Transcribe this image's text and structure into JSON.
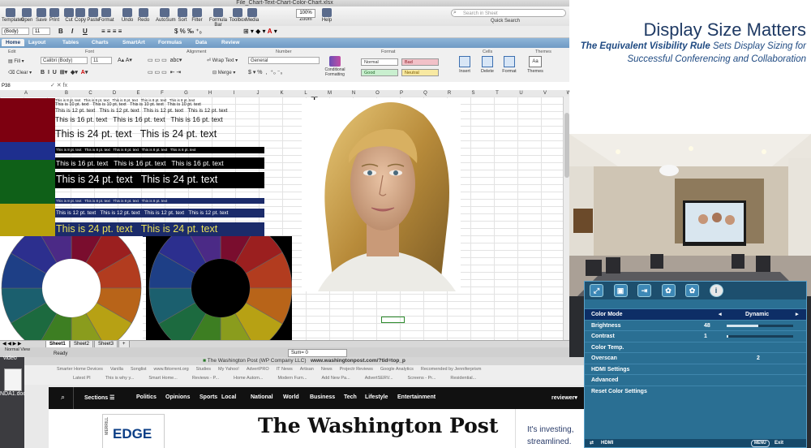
{
  "excel": {
    "window_title": "File_Chart-Text-Chart-Color-Chart.xlsx",
    "toolbar": [
      {
        "icon": "templates-icon",
        "label": "Templates"
      },
      {
        "icon": "open-icon",
        "label": "Open"
      },
      {
        "icon": "save-icon",
        "label": "Save"
      },
      {
        "icon": "print-icon",
        "label": "Print"
      },
      {
        "icon": "cut-icon",
        "label": "Cut"
      },
      {
        "icon": "copy-icon",
        "label": "Copy"
      },
      {
        "icon": "paste-icon",
        "label": "Paste"
      },
      {
        "icon": "format-icon",
        "label": "Format"
      },
      {
        "icon": "undo-icon",
        "label": "Undo"
      },
      {
        "icon": "redo-icon",
        "label": "Redo"
      },
      {
        "icon": "autosum-icon",
        "label": "AutoSum"
      },
      {
        "icon": "sort-icon",
        "label": "Sort"
      },
      {
        "icon": "filter-icon",
        "label": "Filter"
      },
      {
        "icon": "formula-bar-icon",
        "label": "Formula Bar"
      },
      {
        "icon": "toolbox-icon",
        "label": "Toolbox"
      },
      {
        "icon": "media-icon",
        "label": "Media"
      },
      {
        "icon": "zoom-icon",
        "label": "Zoom"
      },
      {
        "icon": "help-icon",
        "label": "Help"
      }
    ],
    "zoom_value": "100%",
    "search_placeholder": "Search in Sheet",
    "quick_search_label": "Quick Search",
    "format_bar": {
      "style": "(Body)",
      "size": "11",
      "bold": "B",
      "italic": "I",
      "underline": "U"
    },
    "ribbon_tabs": [
      "Home",
      "Layout",
      "Tables",
      "Charts",
      "SmartArt",
      "Formulas",
      "Data",
      "Review"
    ],
    "active_tab": "Home",
    "ribbon_groups": {
      "edit": "Edit",
      "font": "Font",
      "alignment": "Alignment",
      "number": "Number",
      "format": "Format",
      "cells": "Cells",
      "themes": "Themes"
    },
    "ribbon": {
      "fill_label": "Fill",
      "clear_label": "Clear",
      "font_name": "Calibri (Body)",
      "font_size": "11",
      "wrap_text": "Wrap Text",
      "merge": "Merge",
      "number_format": "General",
      "conditional_formatting": "Conditional Formatting",
      "styles": {
        "normal": "Normal",
        "bad": "Bad",
        "good": "Good",
        "neutral": "Neutral"
      },
      "insert": "Insert",
      "delete": "Delete",
      "format": "Format",
      "themes": "Themes"
    },
    "name_box": "P38",
    "columns": [
      "A",
      "B",
      "C",
      "D",
      "E",
      "F",
      "G",
      "H",
      "I",
      "J",
      "K",
      "L",
      "M",
      "N",
      "O",
      "P",
      "Q",
      "R",
      "S",
      "T",
      "U",
      "V",
      "W"
    ],
    "text_rows": {
      "t8": "This is 8 pt. text",
      "t10": "This is 10 pt. text",
      "t12": "This is 12 pt. text",
      "t16": "This is 16 pt. text",
      "t24": "This is 24 pt. text"
    },
    "sheet_tabs": [
      "Sheet1",
      "Sheet2",
      "Sheet3"
    ],
    "active_sheet": "Sheet1",
    "status": {
      "view": "Normal View",
      "ready": "Ready",
      "sum": "Sum= 0"
    }
  },
  "slide": {
    "title": "Display Size Matters",
    "subtitle_emphasis": "The Equivalent Visibility Rule",
    "subtitle_rest": " Sets Display Sizing for",
    "subtitle_line2": "Successful Conferencing and Collaboration"
  },
  "osd": {
    "rows": [
      {
        "label": "Color Mode",
        "value": "Dynamic",
        "selected": true
      },
      {
        "label": "Brightness",
        "value": "48",
        "bar": 0.48
      },
      {
        "label": "Contrast",
        "value": "1",
        "bar": 0.01
      },
      {
        "label": "Color Temp.",
        "value": ""
      },
      {
        "label": "Overscan",
        "value": "2"
      },
      {
        "label": "HDMI Settings",
        "value": ""
      },
      {
        "label": "Advanced",
        "value": ""
      },
      {
        "label": "Reset Color Settings",
        "value": ""
      }
    ],
    "footer_source": "HDMI",
    "footer_menu": "MENU",
    "footer_exit": "Exit",
    "icons": [
      "picture-size-icon",
      "picture-icon",
      "input-icon",
      "setup-icon",
      "settings-icon",
      "info-icon"
    ]
  },
  "browser": {
    "title": "The Washington Post (WP Company LLC)",
    "url": "www.washingtonpost.com/?tid=top_p",
    "bookmarks_row1": [
      "Smarter Home Devices",
      "Vanilla",
      "Songlist",
      "www.fbtorrent.org",
      "Studies",
      "My Yahoo!",
      "AdvertPRO",
      "IT News",
      "Artisan",
      "News",
      "Projectr Reviews",
      "Google Analytics",
      "Recomended by Jenniferprism"
    ],
    "bookmarks_row2": [
      "Latest PI",
      "This is why y...",
      "Smart Home...",
      "Reviews - P...",
      "Home Autom...",
      "Modern Furn...",
      "Add New Pa...",
      "AdvertSERV...",
      "Screens - Pr...",
      "Residential..."
    ],
    "nav_sections_label": "Sections",
    "nav_items": [
      "Politics",
      "Opinions",
      "Sports",
      "Local",
      "National",
      "World",
      "Business",
      "Tech",
      "Lifestyle",
      "Entertainment"
    ],
    "nav_right": "reviewer",
    "logo_text": "The Washington Post",
    "ad_left_brand": "MERRILL",
    "ad_left_name": "EDGE",
    "ad_right_line1": "It's investing,",
    "ad_right_line2": "streamlined."
  },
  "desktop": {
    "folder_label": "video",
    "file_label": "NDA1.doc"
  },
  "colors": {
    "accent_blue": "#1f3a64",
    "osd_bg": "#2a6f93",
    "osd_selected": "#0d2e66",
    "excel_ribbon": "#6f9ac4"
  }
}
